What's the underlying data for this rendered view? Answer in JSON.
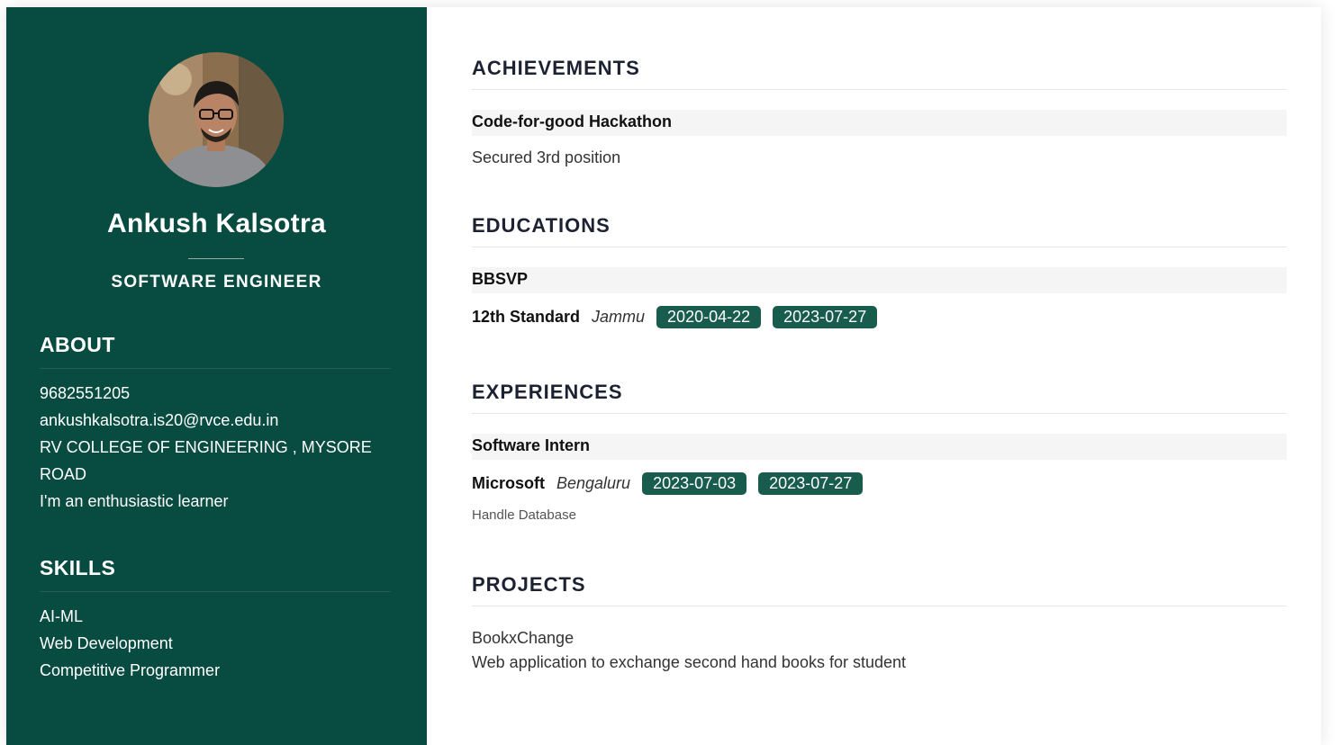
{
  "profile": {
    "name": "Ankush Kalsotra",
    "title": "SOFTWARE ENGINEER"
  },
  "about": {
    "heading": "ABOUT",
    "phone": "9682551205",
    "email": "ankushkalsotra.is20@rvce.edu.in",
    "address_line1": "RV COLLEGE OF ENGINEERING , MYSORE",
    "address_line2": "ROAD",
    "bio": "I'm an enthusiastic learner"
  },
  "skills": {
    "heading": "SKILLS",
    "items": [
      "AI-ML",
      "Web Development",
      "Competitive Programmer"
    ]
  },
  "achievements": {
    "heading": "ACHIEVEMENTS",
    "items": [
      {
        "title": "Code-for-good Hackathon",
        "description": "Secured 3rd position"
      }
    ]
  },
  "educations": {
    "heading": "EDUCATIONS",
    "items": [
      {
        "institution": "BBSVP",
        "degree": "12th Standard",
        "location": "Jammu",
        "start": "2020-04-22",
        "end": "2023-07-27"
      }
    ]
  },
  "experiences": {
    "heading": "EXPERIENCES",
    "items": [
      {
        "role": "Software Intern",
        "company": "Microsoft",
        "location": "Bengaluru",
        "start": "2023-07-03",
        "end": "2023-07-27",
        "description": "Handle Database"
      }
    ]
  },
  "projects": {
    "heading": "PROJECTS",
    "items": [
      {
        "name": "BookxChange",
        "description": "Web application to exchange second hand books for student"
      }
    ]
  },
  "colors": {
    "sidebar_bg": "#084c41",
    "badge_bg": "#185c4e"
  }
}
